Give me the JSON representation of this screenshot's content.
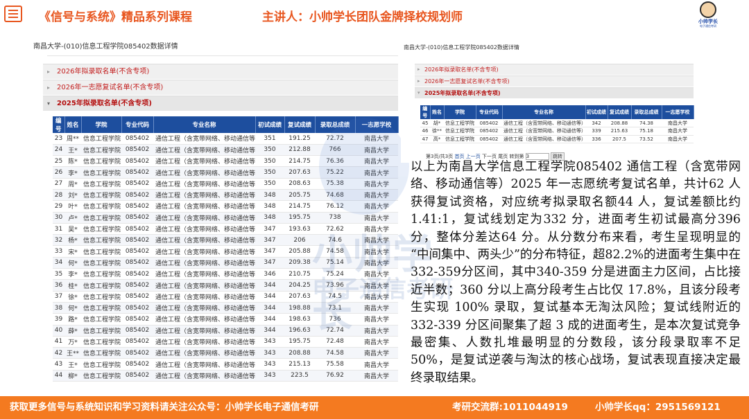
{
  "header": {
    "title": "《信号与系统》精品系列课程",
    "speaker": "主讲人：小帅学长团队金牌择校规划师",
    "logo_name": "小帅学长",
    "logo_sub": "电子通信考研"
  },
  "left_panel": {
    "title": "南昌大学-(010)信息工程学院085402数据详情",
    "sections": [
      "2026年拟录取名单(不含专项)",
      "2026年一志愿复试名单(不含专项)",
      "2025年拟录取名单(不含专项)"
    ],
    "columns": [
      "编号",
      "姓名",
      "学院",
      "专业代码",
      "专业名称",
      "初试成绩",
      "复试成绩",
      "录取总成绩",
      "一志愿学校"
    ],
    "rows": [
      [
        "23",
        "周**",
        "信息工程学院",
        "085402",
        "通信工程（含宽带网络、移动通信等）",
        "351",
        "191.25",
        "72.72",
        "南昌大学"
      ],
      [
        "24",
        "王*",
        "信息工程学院",
        "085402",
        "通信工程（含宽带网络、移动通信等）",
        "350",
        "212.88",
        "766",
        "南昌大学"
      ],
      [
        "25",
        "陈*",
        "信息工程学院",
        "085402",
        "通信工程（含宽带网络、移动通信等）",
        "350",
        "214.75",
        "76.36",
        "南昌大学"
      ],
      [
        "26",
        "李*",
        "信息工程学院",
        "085402",
        "通信工程（含宽带网络、移动通信等）",
        "350",
        "207.63",
        "75.22",
        "南昌大学"
      ],
      [
        "27",
        "周*",
        "信息工程学院",
        "085402",
        "通信工程（含宽带网络、移动通信等）",
        "350",
        "208.63",
        "75.38",
        "南昌大学"
      ],
      [
        "28",
        "刘*",
        "信息工程学院",
        "085402",
        "通信工程（含宽带网络、移动通信等）",
        "348",
        "205.75",
        "74.68",
        "南昌大学"
      ],
      [
        "29",
        "叶*",
        "信息工程学院",
        "085402",
        "通信工程（含宽带网络、移动通信等）",
        "348",
        "214.75",
        "76.12",
        "南昌大学"
      ],
      [
        "30",
        "卢*",
        "信息工程学院",
        "085402",
        "通信工程（含宽带网络、移动通信等）",
        "348",
        "195.75",
        "738",
        "南昌大学"
      ],
      [
        "31",
        "吴*",
        "信息工程学院",
        "085402",
        "通信工程（含宽带网络、移动通信等）",
        "347",
        "193.63",
        "72.62",
        "南昌大学"
      ],
      [
        "32",
        "杨*",
        "信息工程学院",
        "085402",
        "通信工程（含宽带网络、移动通信等）",
        "347",
        "206",
        "74.6",
        "南昌大学"
      ],
      [
        "33",
        "宋*",
        "信息工程学院",
        "085402",
        "通信工程（含宽带网络、移动通信等）",
        "347",
        "205.88",
        "74.58",
        "南昌大学"
      ],
      [
        "34",
        "何*",
        "信息工程学院",
        "085402",
        "通信工程（含宽带网络、移动通信等）",
        "347",
        "209.38",
        "75.14",
        "南昌大学"
      ],
      [
        "35",
        "李*",
        "信息工程学院",
        "085402",
        "通信工程（含宽带网络、移动通信等）",
        "346",
        "210.75",
        "75.24",
        "南昌大学"
      ],
      [
        "36",
        "桂*",
        "信息工程学院",
        "085402",
        "通信工程（含宽带网络、移动通信等）",
        "344",
        "204.25",
        "73.96",
        "南昌大学"
      ],
      [
        "37",
        "徐*",
        "信息工程学院",
        "085402",
        "通信工程（含宽带网络、移动通信等）",
        "344",
        "207.63",
        "74.5",
        "南昌大学"
      ],
      [
        "38",
        "何*",
        "信息工程学院",
        "085402",
        "通信工程（含宽带网络、移动通信等）",
        "344",
        "198.88",
        "73.1",
        "南昌大学"
      ],
      [
        "39",
        "路*",
        "信息工程学院",
        "085402",
        "通信工程（含宽带网络、移动通信等）",
        "344",
        "198.63",
        "736",
        "南昌大学"
      ],
      [
        "40",
        "薛*",
        "信息工程学院",
        "085402",
        "通信工程（含宽带网络、移动通信等）",
        "344",
        "196.63",
        "72.74",
        "南昌大学"
      ],
      [
        "41",
        "万*",
        "信息工程学院",
        "085402",
        "通信工程（含宽带网络、移动通信等）",
        "343",
        "195.75",
        "72.48",
        "南昌大学"
      ],
      [
        "42",
        "王**",
        "信息工程学院",
        "085402",
        "通信工程（含宽带网络、移动通信等）",
        "343",
        "208.88",
        "74.58",
        "南昌大学"
      ],
      [
        "43",
        "王*",
        "信息工程学院",
        "085402",
        "通信工程（含宽带网络、移动通信等）",
        "343",
        "215.13",
        "75.58",
        "南昌大学"
      ],
      [
        "44",
        "柳*",
        "信息工程学院",
        "085402",
        "通信工程（含宽带网络、移动通信等）",
        "343",
        "223.5",
        "76.92",
        "南昌大学"
      ]
    ]
  },
  "right_panel": {
    "title": "南昌大学-(010)信息工程学院085402数据详情",
    "sections": [
      "2026年拟录取名单(不含专项)",
      "2026年一志愿复试名单(不含专项)",
      "2025年拟录取名单(不含专项)"
    ],
    "columns": [
      "编号",
      "姓名",
      "学院",
      "专业代码",
      "专业名称",
      "初试成绩",
      "复试成绩",
      "录取总成绩",
      "一志愿学校"
    ],
    "rows": [
      [
        "45",
        "胡*",
        "信息工程学院",
        "085402",
        "通信工程（含宽带网络、移动通信等）",
        "342",
        "208.88",
        "74.38",
        "南昌大学"
      ],
      [
        "46",
        "徐**",
        "信息工程学院",
        "085402",
        "通信工程（含宽带网络、移动通信等）",
        "339",
        "215.63",
        "75.18",
        "南昌大学"
      ],
      [
        "47",
        "高*",
        "信息工程学院",
        "085402",
        "通信工程（含宽带网络、移动通信等）",
        "336",
        "207.5",
        "73.52",
        "南昌大学"
      ]
    ],
    "pager": {
      "info": "第3页/共3页",
      "first": "首页",
      "prev": "上一页",
      "next": "下一页",
      "last": "尾页",
      "goto": "转到第",
      "page_value": "3",
      "jump": "跳转"
    }
  },
  "analysis": "以上为南昌大学信息工程学院085402 通信工程（含宽带网络、移动通信等）2025 年一志愿统考复试名单，共计62 人获得复试资格，对应统考拟录取名额44 人，复试差额比约1.41:1，复试线划定为332 分，进面考生初试最高分396 分，整体分差达64 分。从分数分布来看，考生呈现明显的 “中间集中、两头少”的分布特征，超82.2%的进面考生集中在332-359分区间，其中340-359 分是进面主力区间，占比接近半数；360 分以上高分段考生占比仅 17.8%，且该分段考生实现 100% 录取，复试基本无淘汰风险；复试线附近的332-339 分区间聚集了超 3 成的进面考生，是本次复试竞争最密集、人数扎堆最明显的分数段，该分段录取率不足 50%，是复试逆袭与淘汰的核心战场，复试表现直接决定最终录取结果。",
  "footer": {
    "follow": "获取更多信号与系统知识和学习资料请关注公众号：小帅学长电子通信考研",
    "group": "考研交流群:1011044919",
    "qq": "小帅学长qq：2951569121"
  },
  "watermark": {
    "line1": "小帅学长",
    "line2": "电子通信考研"
  },
  "colors": {
    "accent": "#e8561f",
    "table_header": "#1d4e9e",
    "footer": "#f47a20",
    "section_red": "#c21d1d"
  }
}
